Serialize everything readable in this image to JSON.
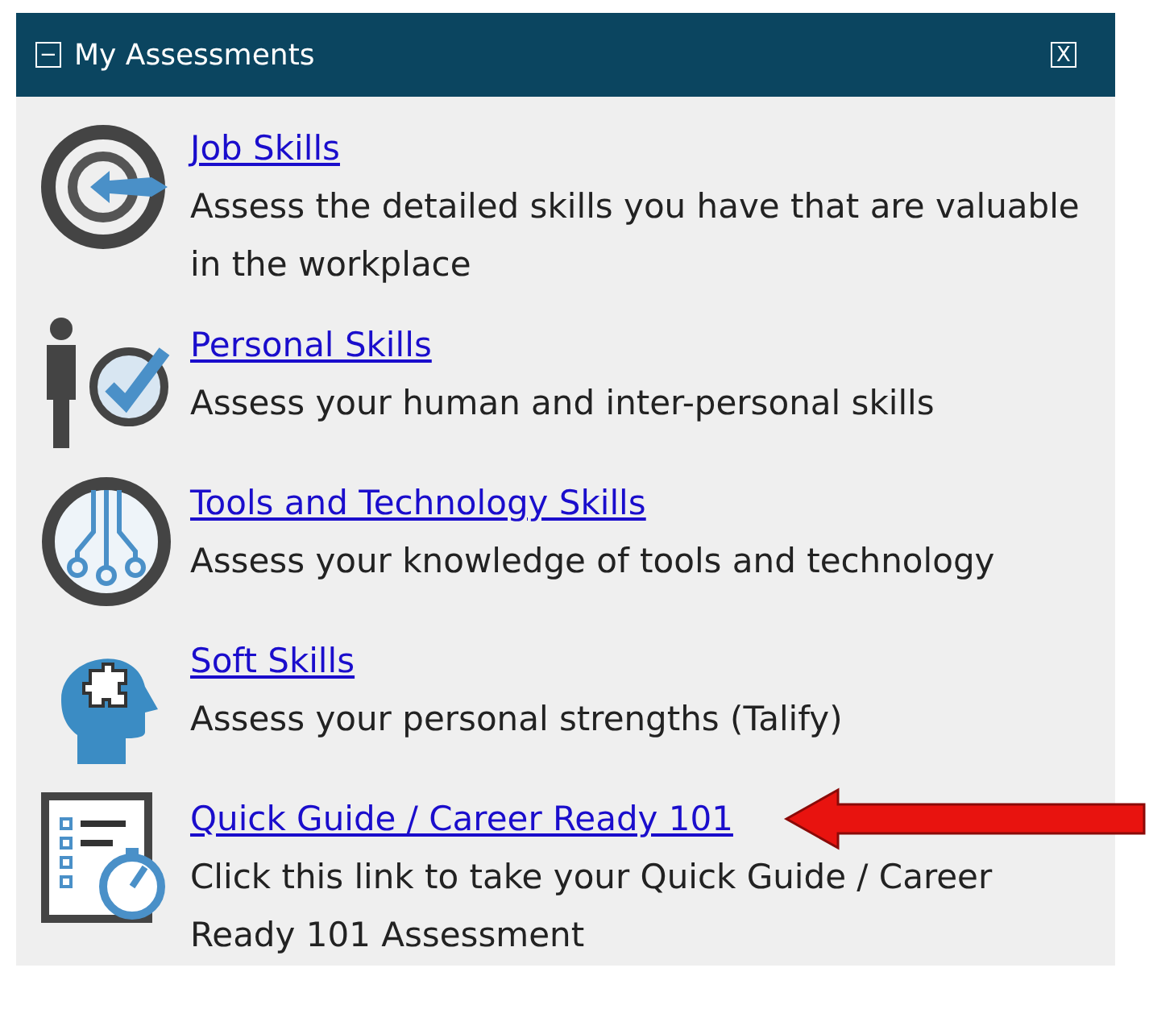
{
  "panel": {
    "title": "My Assessments",
    "collapse_icon": "−",
    "close_icon": "X"
  },
  "items": [
    {
      "kind": "target",
      "link": "Job Skills",
      "description": "Assess the detailed skills you have that are valuable in the workplace",
      "pointed_at": false
    },
    {
      "kind": "person-check",
      "link": "Personal Skills",
      "description": "Assess your human and inter-personal skills",
      "pointed_at": false
    },
    {
      "kind": "circuit",
      "link": "Tools and Technology Skills",
      "description": "Assess your knowledge of tools and technology",
      "pointed_at": false
    },
    {
      "kind": "head-puzzle",
      "link": "Soft Skills",
      "description": "Assess your personal strengths (Talify)",
      "pointed_at": false
    },
    {
      "kind": "checklist-timer",
      "link": "Quick Guide / Career Ready 101",
      "description": "Click this link to take your Quick Guide / Career Ready 101 Assessment",
      "pointed_at": true
    }
  ]
}
